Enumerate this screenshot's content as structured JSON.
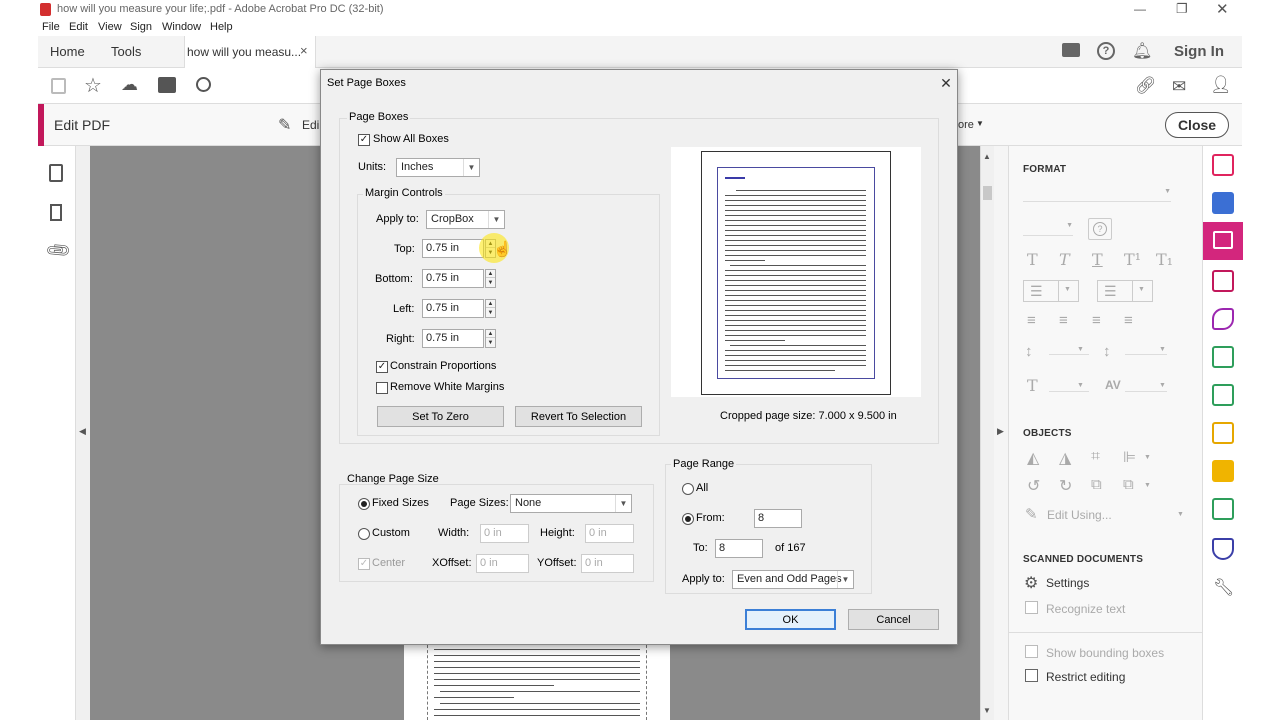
{
  "window": {
    "title": "how will you measure your life;.pdf - Adobe Acrobat Pro DC (32-bit)",
    "menu": [
      "File",
      "Edit",
      "View",
      "Sign",
      "Window",
      "Help"
    ]
  },
  "tabs": {
    "home": "Home",
    "tools": "Tools",
    "document": "how will you measu...",
    "close": "×",
    "sign_in": "Sign In"
  },
  "editbar": {
    "title": "Edit PDF",
    "edit_partial": "Edi",
    "more_partial": "ore",
    "close_label": "Close"
  },
  "format_panel": {
    "format_heading": "FORMAT",
    "objects_heading": "OBJECTS",
    "edit_using": "Edit Using...",
    "scanned_heading": "SCANNED DOCUMENTS",
    "settings": "Settings",
    "recognize_text": "Recognize text",
    "show_bounding_boxes": "Show bounding boxes",
    "restrict_editing": "Restrict editing",
    "text_style_icons": [
      "T",
      "T",
      "T",
      "T¹",
      "T₁"
    ]
  },
  "dialog": {
    "title": "Set Page Boxes",
    "page_boxes_heading": "Page Boxes",
    "show_all_boxes": "Show All Boxes",
    "show_all_boxes_checked": true,
    "units_label": "Units:",
    "units_value": "Inches",
    "margin_controls_heading": "Margin Controls",
    "apply_to_label": "Apply to:",
    "apply_to_value": "CropBox",
    "top_label": "Top:",
    "top_value": "0.75 in",
    "bottom_label": "Bottom:",
    "bottom_value": "0.75 in",
    "left_label": "Left:",
    "left_value": "0.75 in",
    "right_label": "Right:",
    "right_value": "0.75 in",
    "constrain_proportions": "Constrain Proportions",
    "constrain_checked": true,
    "remove_white_margins": "Remove White Margins",
    "remove_white_checked": false,
    "set_to_zero": "Set To Zero",
    "revert_to_selection": "Revert To Selection",
    "cropped_size": "Cropped page size: 7.000 x 9.500 in",
    "change_page_size_heading": "Change Page Size",
    "fixed_sizes": "Fixed Sizes",
    "page_sizes_label": "Page Sizes:",
    "page_sizes_value": "None",
    "custom": "Custom",
    "width_label": "Width:",
    "width_value": "0 in",
    "height_label": "Height:",
    "height_value": "0 in",
    "center": "Center",
    "xoffset_label": "XOffset:",
    "xoffset_value": "0 in",
    "yoffset_label": "YOffset:",
    "yoffset_value": "0 in",
    "page_range_heading": "Page Range",
    "all_label": "All",
    "from_label": "From:",
    "from_value": "8",
    "to_label": "To:",
    "to_value": "8",
    "of_total": "of 167",
    "range_apply_to_label": "Apply to:",
    "range_apply_to_value": "Even and Odd Pages",
    "ok": "OK",
    "cancel": "Cancel"
  },
  "colors": {
    "accent": "#c2185b",
    "dialog_bg": "#f0f0f0",
    "doc_bg": "#8a8a8a",
    "ok_border": "#3c7fd6"
  }
}
